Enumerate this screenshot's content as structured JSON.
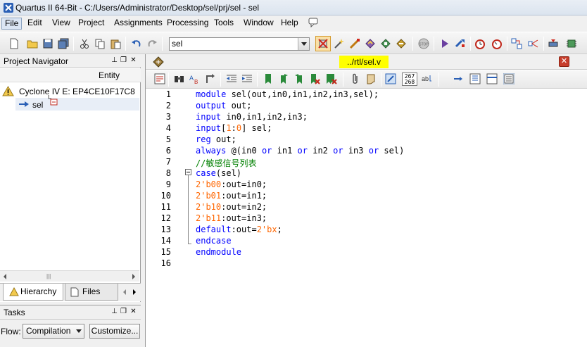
{
  "window": {
    "title": "Quartus II 64-Bit - C:/Users/Administrator/Desktop/sel/prj/sel - sel"
  },
  "menu": {
    "items": [
      "File",
      "Edit",
      "View",
      "Project",
      "Assignments",
      "Processing",
      "Tools",
      "Window",
      "Help"
    ]
  },
  "toolbar": {
    "entity_value": "sel"
  },
  "project_navigator": {
    "title": "Project Navigator",
    "column_header": "Entity",
    "device": "Cyclone IV E: EP4CE10F17C8",
    "top_entity": "sel",
    "tabs": [
      "Hierarchy",
      "Files"
    ]
  },
  "tasks": {
    "title": "Tasks",
    "flow_label": "Flow:",
    "flow_value": "Compilation",
    "customize_label": "Customize..."
  },
  "editor": {
    "file_tab": "../rtl/sel.v",
    "editor_toolbar_label_267": "267\n268",
    "lines": [
      [
        {
          "t": "module ",
          "c": "kw"
        },
        {
          "t": "sel(out,in0,in1,in2,in3,sel);",
          "c": ""
        }
      ],
      [
        {
          "t": "output ",
          "c": "kw"
        },
        {
          "t": "out;",
          "c": ""
        }
      ],
      [
        {
          "t": "input ",
          "c": "kw"
        },
        {
          "t": "in0,in1,in2,in3;",
          "c": ""
        }
      ],
      [
        {
          "t": "input",
          "c": "kw"
        },
        {
          "t": "[",
          "c": ""
        },
        {
          "t": "1",
          "c": "num"
        },
        {
          "t": ":",
          "c": ""
        },
        {
          "t": "0",
          "c": "num"
        },
        {
          "t": "] sel;",
          "c": ""
        }
      ],
      [
        {
          "t": "reg ",
          "c": "kw"
        },
        {
          "t": "out;",
          "c": ""
        }
      ],
      [
        {
          "t": "always ",
          "c": "kw"
        },
        {
          "t": "@(in0 ",
          "c": ""
        },
        {
          "t": "or ",
          "c": "kw"
        },
        {
          "t": "in1 ",
          "c": ""
        },
        {
          "t": "or ",
          "c": "kw"
        },
        {
          "t": "in2 ",
          "c": ""
        },
        {
          "t": "or ",
          "c": "kw"
        },
        {
          "t": "in3 ",
          "c": ""
        },
        {
          "t": "or ",
          "c": "kw"
        },
        {
          "t": "sel)",
          "c": ""
        }
      ],
      [
        {
          "t": "//敏感信号列表",
          "c": "cmt"
        }
      ],
      [
        {
          "t": "case",
          "c": "kw"
        },
        {
          "t": "(sel)",
          "c": ""
        }
      ],
      [
        {
          "t": "2'b00",
          "c": "num"
        },
        {
          "t": ":out=in0;",
          "c": ""
        }
      ],
      [
        {
          "t": "2'b01",
          "c": "num"
        },
        {
          "t": ":out=in1;",
          "c": ""
        }
      ],
      [
        {
          "t": "2'b10",
          "c": "num"
        },
        {
          "t": ":out=in2;",
          "c": ""
        }
      ],
      [
        {
          "t": "2'b11",
          "c": "num"
        },
        {
          "t": ":out=in3;",
          "c": ""
        }
      ],
      [
        {
          "t": "default",
          "c": "kw"
        },
        {
          "t": ":out=",
          "c": ""
        },
        {
          "t": "2'bx",
          "c": "num"
        },
        {
          "t": ";",
          "c": ""
        }
      ],
      [
        {
          "t": "endcase",
          "c": "kw"
        }
      ],
      [
        {
          "t": "endmodule",
          "c": "kw"
        }
      ],
      []
    ]
  }
}
